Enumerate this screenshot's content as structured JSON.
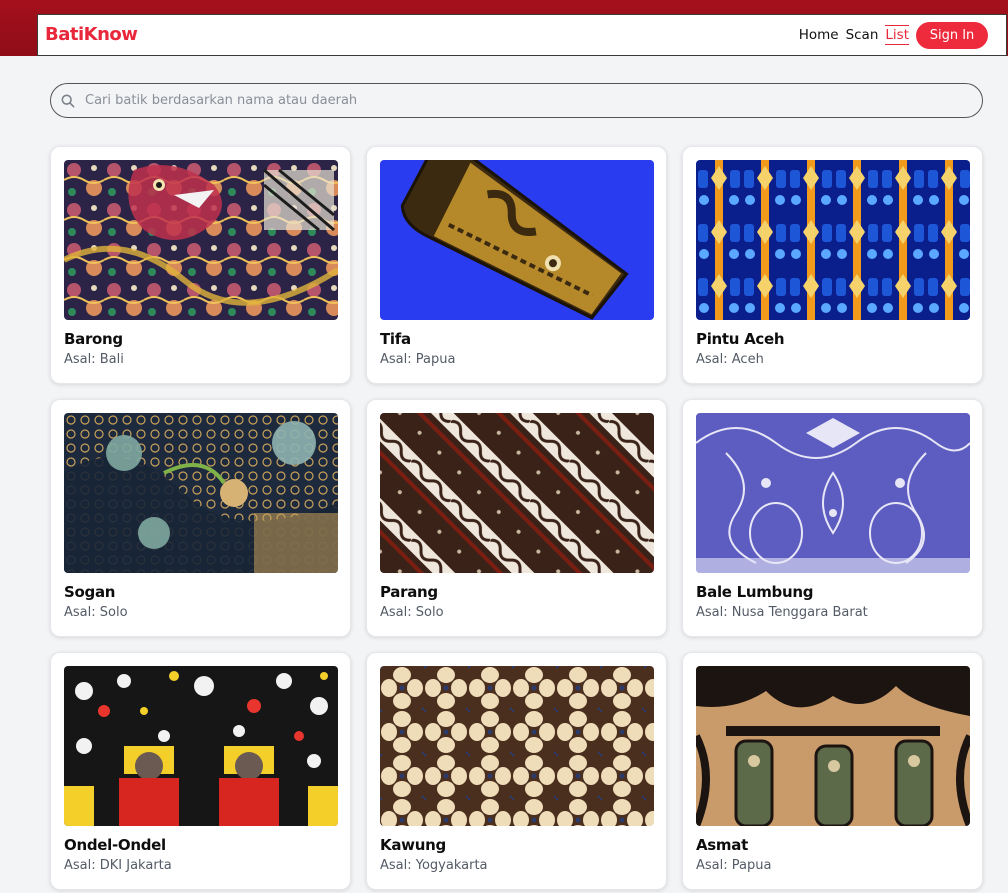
{
  "brand": {
    "name": "BatiKnow",
    "color": "#e8283a",
    "band_color": "#a4101c"
  },
  "nav": {
    "links": [
      {
        "label": "Home",
        "active": false
      },
      {
        "label": "Scan",
        "active": false
      },
      {
        "label": "List",
        "active": true
      }
    ],
    "signin_label": "Sign In"
  },
  "search": {
    "placeholder": "Cari batik berdasarkan nama atau daerah",
    "value": "",
    "icon": "search-icon"
  },
  "batik": [
    {
      "name": "Barong",
      "origin": "Asal: Bali",
      "pattern": "barong"
    },
    {
      "name": "Tifa",
      "origin": "Asal: Papua",
      "pattern": "tifa"
    },
    {
      "name": "Pintu Aceh",
      "origin": "Asal: Aceh",
      "pattern": "pintu-aceh"
    },
    {
      "name": "Sogan",
      "origin": "Asal: Solo",
      "pattern": "sogan"
    },
    {
      "name": "Parang",
      "origin": "Asal: Solo",
      "pattern": "parang"
    },
    {
      "name": "Bale Lumbung",
      "origin": "Asal: Nusa Tenggara Barat",
      "pattern": "bale-lumbung"
    },
    {
      "name": "Ondel-Ondel",
      "origin": "Asal: DKI Jakarta",
      "pattern": "ondel-ondel"
    },
    {
      "name": "Kawung",
      "origin": "Asal: Yogyakarta",
      "pattern": "kawung"
    },
    {
      "name": "Asmat",
      "origin": "Asal: Papua",
      "pattern": "asmat"
    }
  ]
}
